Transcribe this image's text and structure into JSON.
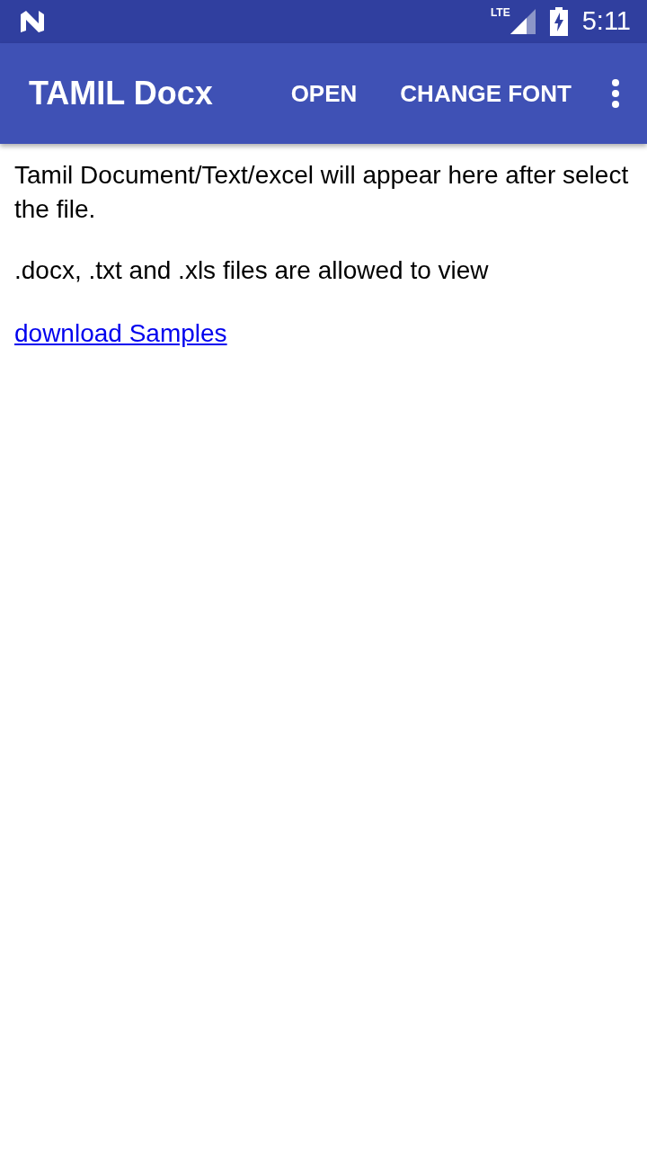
{
  "status_bar": {
    "network": "LTE",
    "time": "5:11"
  },
  "app_bar": {
    "title": "TAMIL Docx",
    "actions": [
      "OPEN",
      "CHANGE FONT"
    ]
  },
  "content": {
    "paragraphs": [
      "Tamil Document/Text/excel will appear here after select the file.",
      ".docx, .txt and .xls files are allowed to view"
    ],
    "link": "download Samples"
  }
}
